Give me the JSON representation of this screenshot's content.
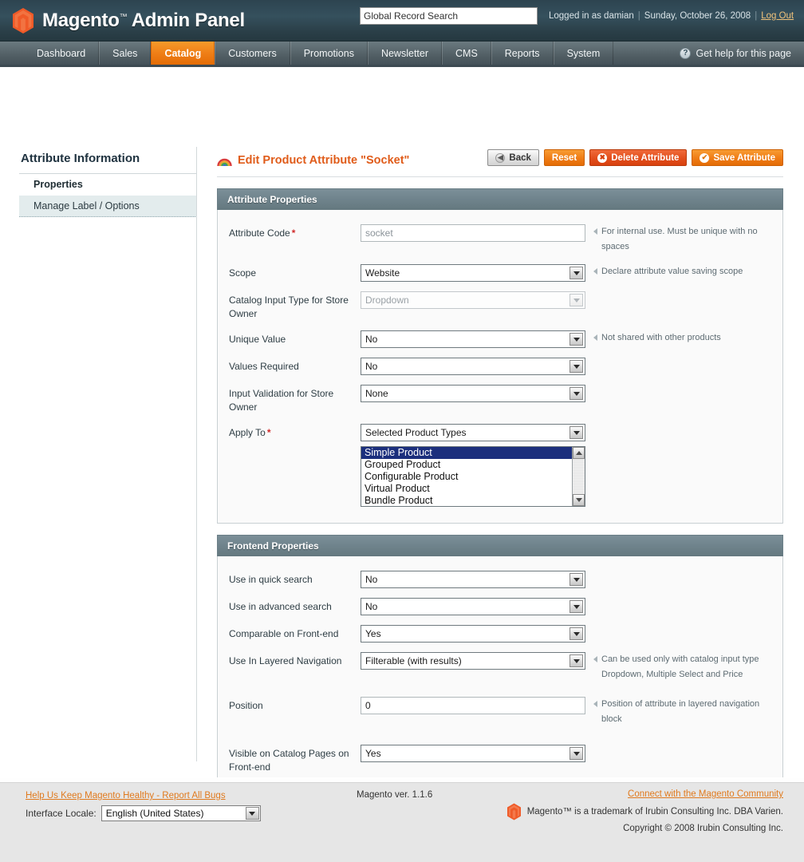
{
  "header": {
    "logo_text": "Magento",
    "logo_tm": "™",
    "logo_suffix": "Admin Panel",
    "search_value": "Global Record Search",
    "search_placeholder": "Global Record Search",
    "logged_in_as": "Logged in as damian",
    "date": "Sunday, October 26, 2008",
    "logout": "Log Out",
    "separator": "|"
  },
  "nav": {
    "items": [
      {
        "label": "Dashboard",
        "active": false
      },
      {
        "label": "Sales",
        "active": false
      },
      {
        "label": "Catalog",
        "active": true
      },
      {
        "label": "Customers",
        "active": false
      },
      {
        "label": "Promotions",
        "active": false
      },
      {
        "label": "Newsletter",
        "active": false
      },
      {
        "label": "CMS",
        "active": false
      },
      {
        "label": "Reports",
        "active": false
      },
      {
        "label": "System",
        "active": false
      }
    ],
    "help_label": "Get help for this page",
    "help_icon_glyph": "?"
  },
  "sidebar": {
    "title": "Attribute Information",
    "items": [
      {
        "label": "Properties",
        "state": "current"
      },
      {
        "label": "Manage Label / Options",
        "state": "selected"
      }
    ]
  },
  "page": {
    "title": "Edit Product Attribute \"Socket\"",
    "buttons": [
      {
        "label": "Back",
        "style": "grey",
        "icon": "back-arrow-icon",
        "glyph": "◀"
      },
      {
        "label": "Reset",
        "style": "orange",
        "icon": null,
        "glyph": ""
      },
      {
        "label": "Delete Attribute",
        "style": "red",
        "icon": "delete-circle-icon",
        "glyph": "✖"
      },
      {
        "label": "Save Attribute",
        "style": "orange",
        "icon": "check-circle-icon",
        "glyph": "✔"
      }
    ]
  },
  "attribute_properties": {
    "heading": "Attribute Properties",
    "fields": [
      {
        "label": "Attribute Code",
        "required": true,
        "type": "text",
        "value": "socket",
        "placeholder": "socket",
        "disabled": false,
        "note": "For internal use. Must be unique with no spaces"
      },
      {
        "label": "Scope",
        "required": false,
        "type": "select",
        "value": "Website",
        "disabled": false,
        "note": "Declare attribute value saving scope"
      },
      {
        "label": "Catalog Input Type for Store Owner",
        "required": false,
        "type": "select",
        "value": "Dropdown",
        "disabled": true,
        "note": ""
      },
      {
        "label": "Unique Value",
        "required": false,
        "type": "select",
        "value": "No",
        "disabled": false,
        "note": "Not shared with other products"
      },
      {
        "label": "Values Required",
        "required": false,
        "type": "select",
        "value": "No",
        "disabled": false,
        "note": ""
      },
      {
        "label": "Input Validation for Store Owner",
        "required": false,
        "type": "select",
        "value": "None",
        "disabled": false,
        "note": ""
      },
      {
        "label": "Apply To",
        "required": true,
        "type": "select",
        "value": "Selected Product Types",
        "disabled": false,
        "note": ""
      }
    ],
    "product_types": [
      {
        "label": "Simple Product",
        "selected": true
      },
      {
        "label": "Grouped Product",
        "selected": false
      },
      {
        "label": "Configurable Product",
        "selected": false
      },
      {
        "label": "Virtual Product",
        "selected": false
      },
      {
        "label": "Bundle Product",
        "selected": false
      }
    ]
  },
  "frontend_properties": {
    "heading": "Frontend Properties",
    "fields": [
      {
        "label": "Use in quick search",
        "required": false,
        "type": "select",
        "value": "No",
        "disabled": false,
        "note": ""
      },
      {
        "label": "Use in advanced search",
        "required": false,
        "type": "select",
        "value": "No",
        "disabled": false,
        "note": ""
      },
      {
        "label": "Comparable on Front-end",
        "required": false,
        "type": "select",
        "value": "Yes",
        "disabled": false,
        "note": ""
      },
      {
        "label": "Use In Layered Navigation",
        "required": false,
        "type": "select",
        "value": "Filterable (with results)",
        "disabled": false,
        "note": "Can be used only with catalog input type Dropdown, Multiple Select and Price"
      },
      {
        "label": "Position",
        "required": false,
        "type": "text",
        "value": "0",
        "placeholder": "",
        "disabled": false,
        "note": "Position of attribute in layered navigation block"
      },
      {
        "label": "Visible on Catalog Pages on Front-end",
        "required": false,
        "type": "select",
        "value": "Yes",
        "disabled": false,
        "note": ""
      }
    ]
  },
  "footer": {
    "bugs_link": "Help Us Keep Magento Healthy - Report All Bugs",
    "locale_label": "Interface Locale:",
    "locale_value": "English (United States)",
    "version": "Magento ver. 1.1.6",
    "community_link": "Connect with the Magento Community",
    "trademark": "Magento™ is a trademark of Irubin Consulting Inc. DBA Varien.",
    "copyright": "Copyright © 2008 Irubin Consulting Inc."
  },
  "colors": {
    "header_dark": "#2d4450",
    "nav_grey": "#5c6a70",
    "accent_orange": "#ef7f17",
    "title_orange": "#e05c1a",
    "panel_head_slate": "#6f838c",
    "select_highlight": "#1b2f7d",
    "required_red": "#d02b2b",
    "link_orange": "#e07a1e"
  }
}
